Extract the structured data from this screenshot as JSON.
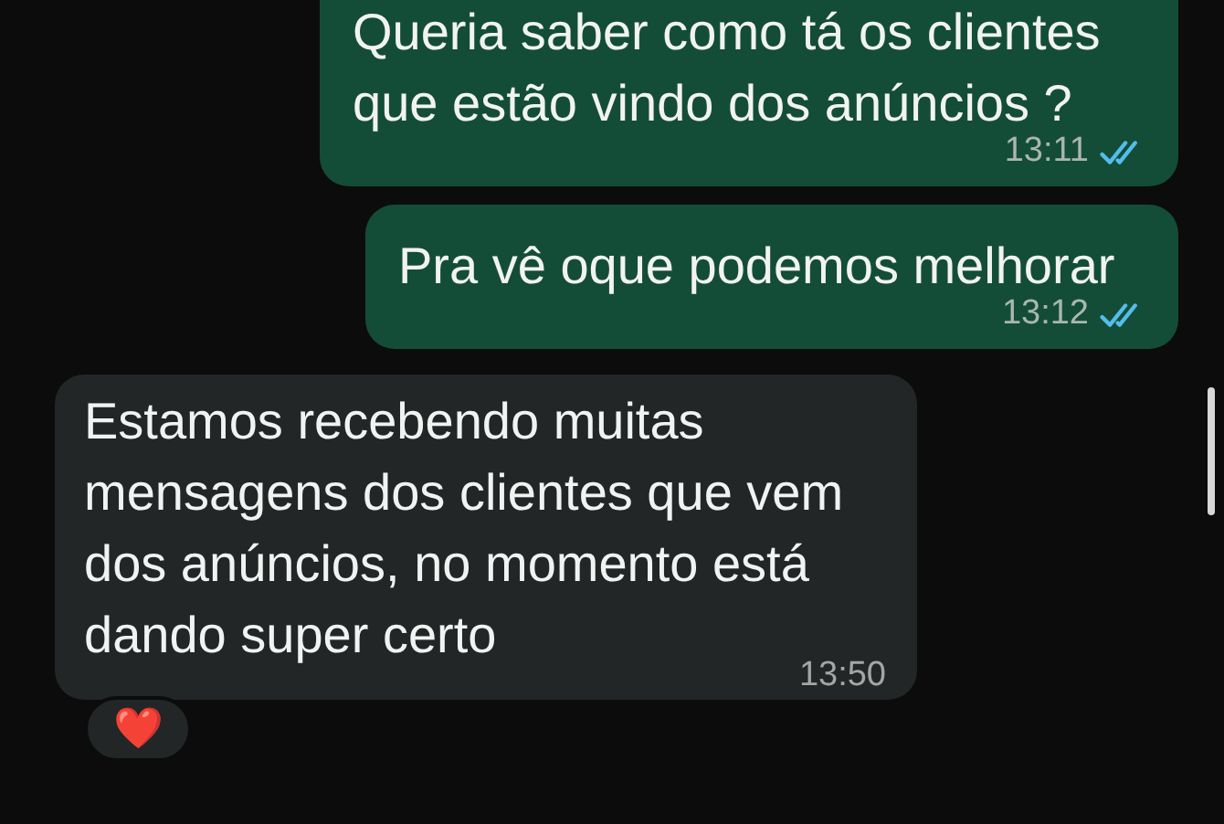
{
  "messages": [
    {
      "kind": "outgoing",
      "text": "Queria saber como tá os clientes que estão vindo dos anúncios ?",
      "time": "13:11",
      "read": true
    },
    {
      "kind": "outgoing",
      "text": "Pra vê oque podemos melhorar",
      "time": "13:12",
      "read": true
    },
    {
      "kind": "incoming",
      "text": "Estamos recebendo muitas mensagens dos clientes que vem dos anúncios, no momento está dando super certo",
      "time": "13:50",
      "reaction": "❤️"
    }
  ]
}
